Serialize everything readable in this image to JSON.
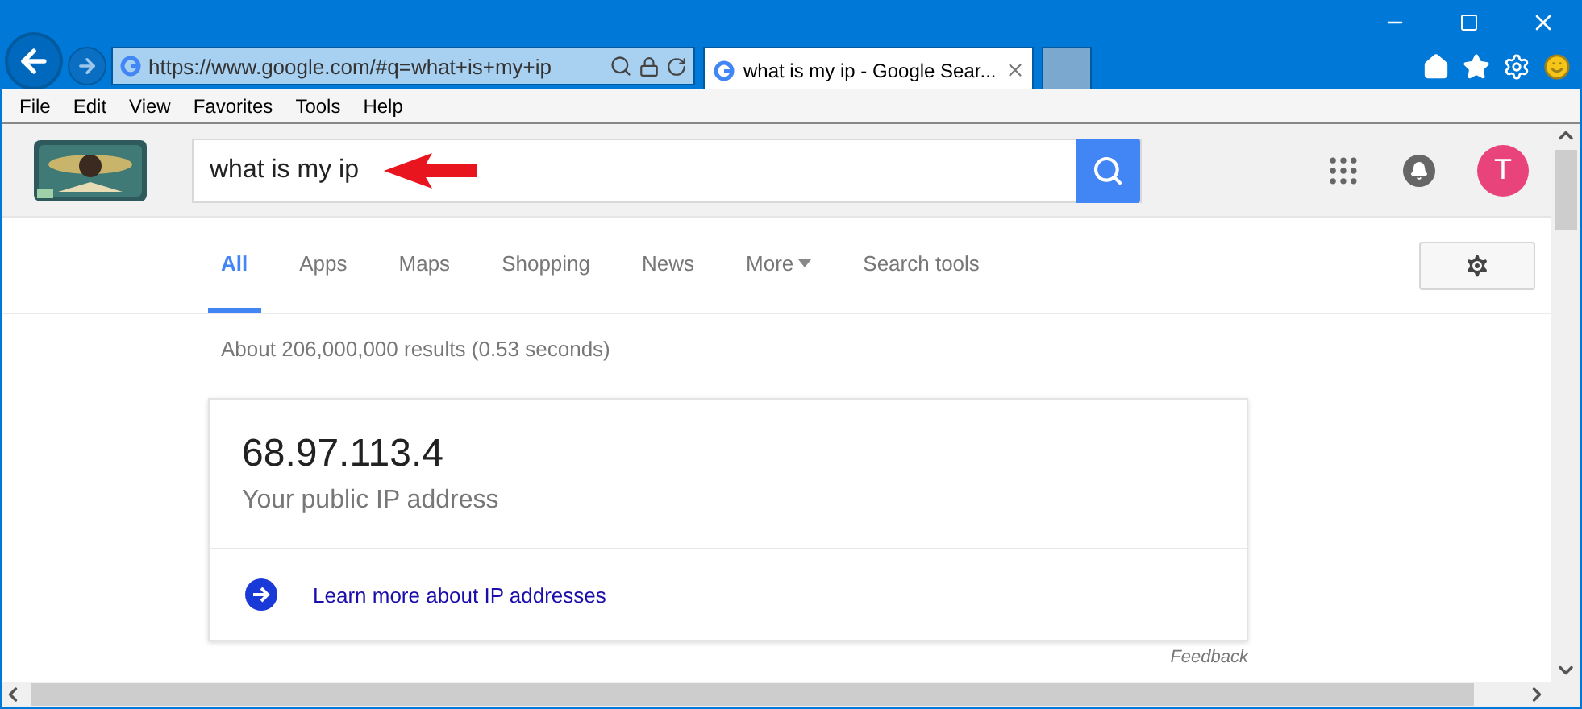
{
  "browser": {
    "address": "https://www.google.com/#q=what+is+my+ip",
    "tabs": [
      {
        "title": "what is my ip - Google Sear...",
        "selected": true
      },
      {
        "selected": false
      }
    ]
  },
  "menu": [
    "File",
    "Edit",
    "View",
    "Favorites",
    "Tools",
    "Help"
  ],
  "search": {
    "value": "what is my ip"
  },
  "account": {
    "initial": "T"
  },
  "nav": [
    {
      "label": "All",
      "selected": true,
      "kind": "tab"
    },
    {
      "label": "Apps",
      "selected": false,
      "kind": "tab"
    },
    {
      "label": "Maps",
      "selected": false,
      "kind": "tab"
    },
    {
      "label": "Shopping",
      "selected": false,
      "kind": "tab"
    },
    {
      "label": "News",
      "selected": false,
      "kind": "tab"
    },
    {
      "label": "More",
      "selected": false,
      "kind": "dropdown"
    },
    {
      "label": "Search tools",
      "selected": false,
      "kind": "tab"
    }
  ],
  "stats": "About 206,000,000 results (0.53 seconds)",
  "answer": {
    "ip": "68.97.113.4",
    "caption": "Your public IP address",
    "link": "Learn more about IP addresses"
  },
  "feedback": "Feedback"
}
